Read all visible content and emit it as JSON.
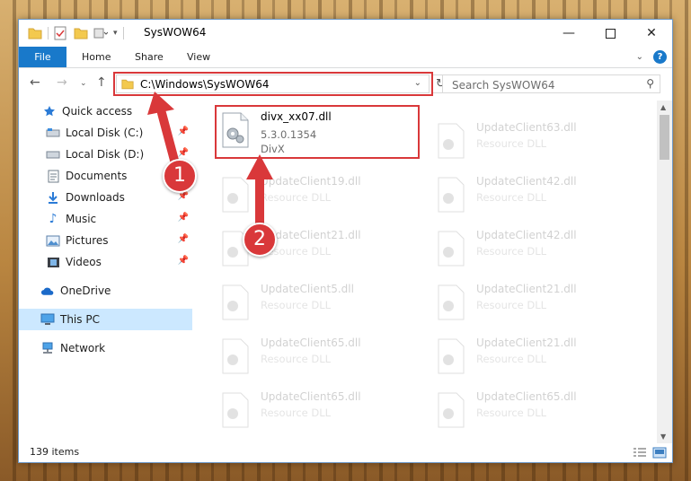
{
  "window": {
    "title": "SysWOW64"
  },
  "ribbon": {
    "tabs": [
      "File",
      "Home",
      "Share",
      "View"
    ],
    "help_label": "?"
  },
  "navigation": {
    "address": "C:\\Windows\\SysWOW64",
    "search_placeholder": "Search SysWOW64"
  },
  "sidebar": {
    "items": [
      {
        "label": "Quick access",
        "icon": "star-icon"
      },
      {
        "label": "Local Disk (C:)",
        "icon": "drive-icon",
        "pinned": true
      },
      {
        "label": "Local Disk (D:)",
        "icon": "drive-icon",
        "pinned": true
      },
      {
        "label": "Documents",
        "icon": "documents-icon",
        "pinned": true
      },
      {
        "label": "Downloads",
        "icon": "download-icon",
        "pinned": true
      },
      {
        "label": "Music",
        "icon": "music-icon",
        "pinned": true
      },
      {
        "label": "Pictures",
        "icon": "pictures-icon",
        "pinned": true
      },
      {
        "label": "Videos",
        "icon": "videos-icon",
        "pinned": true
      },
      {
        "label": "OneDrive",
        "icon": "cloud-icon"
      },
      {
        "label": "This PC",
        "icon": "computer-icon",
        "selected": true
      },
      {
        "label": "Network",
        "icon": "network-icon"
      }
    ]
  },
  "files": {
    "highlighted": {
      "name": "divx_xx07.dll",
      "version": "5.3.0.1354",
      "company": "DivX"
    },
    "column1": [
      {
        "name": "UpdateClient19.dll",
        "type": "Resource DLL"
      },
      {
        "name": "UpdateClient21.dll",
        "type": "Resource DLL"
      },
      {
        "name": "UpdateClient5.dll",
        "type": "Resource DLL"
      },
      {
        "name": "UpdateClient65.dll",
        "type": "Resource DLL"
      },
      {
        "name": "UpdateClient65.dll",
        "type": "Resource DLL"
      }
    ],
    "column2": [
      {
        "name": "UpdateClient63.dll",
        "type": "Resource DLL"
      },
      {
        "name": "UpdateClient42.dll",
        "type": "Resource DLL"
      },
      {
        "name": "UpdateClient42.dll",
        "type": "Resource DLL"
      },
      {
        "name": "UpdateClient21.dll",
        "type": "Resource DLL"
      },
      {
        "name": "UpdateClient21.dll",
        "type": "Resource DLL"
      },
      {
        "name": "UpdateClient65.dll",
        "type": "Resource DLL"
      }
    ]
  },
  "status": {
    "item_count": "139 items"
  },
  "annotations": {
    "step1": "1",
    "step2": "2",
    "color": "#d9383a"
  },
  "colors": {
    "accent": "#1979ca",
    "selection": "#cce8ff"
  }
}
